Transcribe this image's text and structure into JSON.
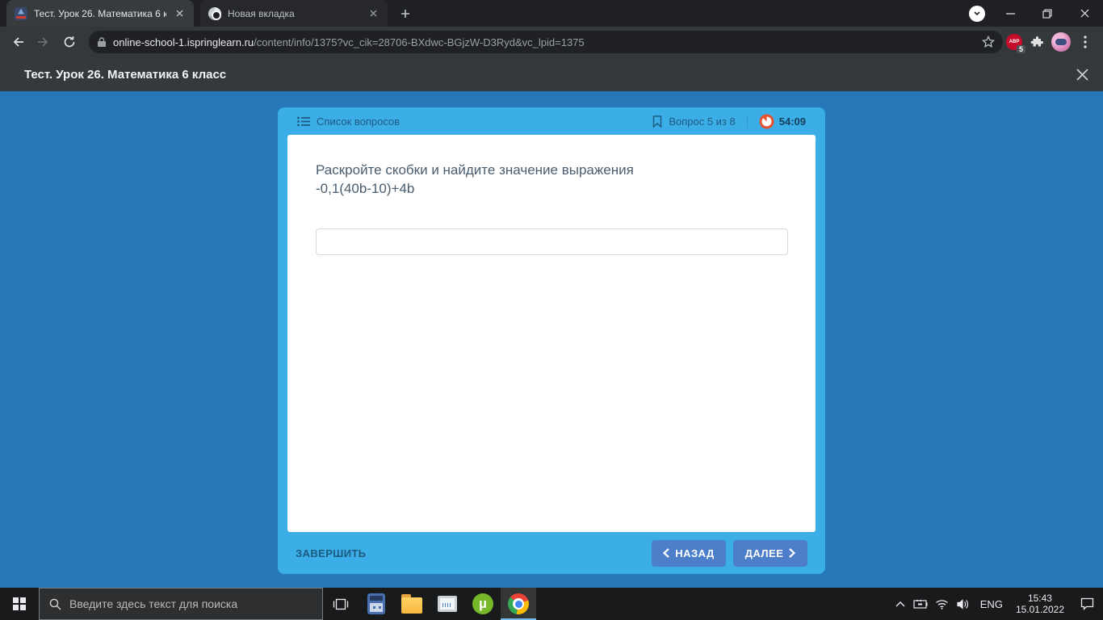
{
  "browser": {
    "tabs": [
      {
        "title": "Тест. Урок 26. Математика 6 кла"
      },
      {
        "title": "Новая вкладка"
      }
    ],
    "address": {
      "domain": "online-school-1.ispringlearn.ru",
      "path": "/content/info/1375?vc_cik=28706-BXdwc-BGjzW-D3Ryd&vc_lpid=1375"
    },
    "extensions": {
      "abp_label": "ABP",
      "abp_badge": "5"
    }
  },
  "page": {
    "header_title": "Тест. Урок 26. Математика 6 класс",
    "quiz": {
      "question_list_label": "Список вопросов",
      "progress_label": "Вопрос 5 из 8",
      "timer_value": "54:09",
      "question_line1": "Раскройте скобки и найдите значение выражения",
      "question_line2": "-0,1(40b-10)+4b",
      "answer_value": "",
      "finish_label": "ЗАВЕРШИТЬ",
      "back_label": "НАЗАД",
      "next_label": "ДАЛЕЕ"
    }
  },
  "taskbar": {
    "search_placeholder": "Введите здесь текст для поиска",
    "utorrent_glyph": "µ",
    "language_label": "ENG",
    "time": "15:43",
    "date": "15.01.2022"
  },
  "colors": {
    "card_blue": "#3baee8",
    "page_blue": "#2778b8",
    "button_blue": "#4c7ec9",
    "timer_red": "#e8512e",
    "quiz_text_blue": "#1f5a80"
  }
}
